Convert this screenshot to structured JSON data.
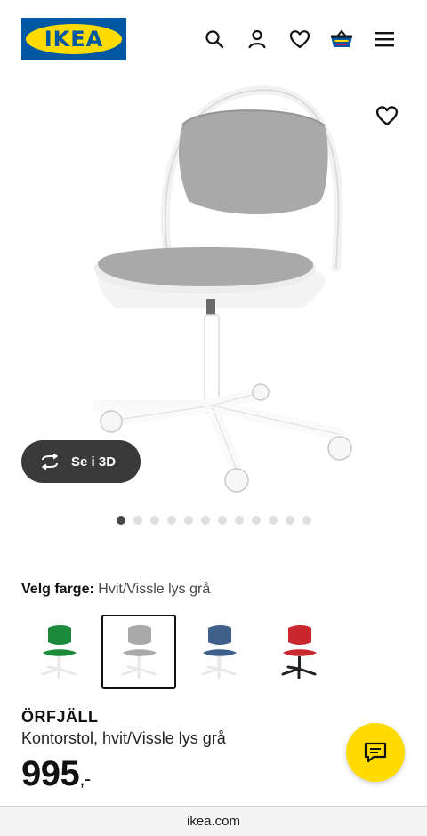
{
  "header": {
    "logo_text": "IKEA",
    "icons": [
      "search-icon",
      "user-icon",
      "heart-icon",
      "basket-icon",
      "menu-icon"
    ]
  },
  "hero": {
    "view_3d_label": "Se i 3D",
    "image_dots_count": 12,
    "active_dot_index": 0
  },
  "color": {
    "label": "Velg farge:",
    "selected_value": "Hvit/Vissle lys grå",
    "swatches": [
      "green",
      "white-light-grey",
      "blue",
      "red-black"
    ],
    "selected_index": 1
  },
  "product": {
    "name": "ÖRFJÄLL",
    "description": "Kontorstol, hvit/Vissle lys grå",
    "price": "995",
    "price_suffix": ",-"
  },
  "browser": {
    "url": "ikea.com"
  },
  "colors": {
    "ikea_blue": "#0058a3",
    "ikea_yellow": "#ffdb00",
    "seat_grey": "#a9a9a9"
  }
}
